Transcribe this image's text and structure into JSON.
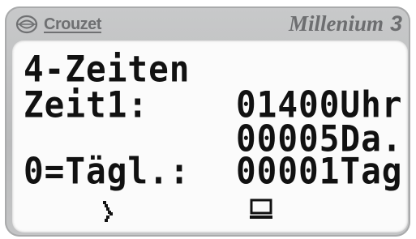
{
  "header": {
    "brand": "Crouzet",
    "model": "Millenium",
    "model_number": "3"
  },
  "display": {
    "line1": "4-Zeiten",
    "line2_label": "Zeit1:",
    "line2_value": "01400Uhr",
    "line3_value": "00005Da.",
    "line4_label": "0=Tägl.:",
    "line4_value": "00001Tag"
  },
  "icons": {
    "brand_logo": "crouzet-logo-icon",
    "cursor": "cursor-arrow-icon",
    "screen": "monitor-icon"
  },
  "colors": {
    "bezel": "#bdbebf",
    "lcd_background": "#fbfbfb",
    "lcd_text": "#111111",
    "brand_text": "#6f7072"
  }
}
